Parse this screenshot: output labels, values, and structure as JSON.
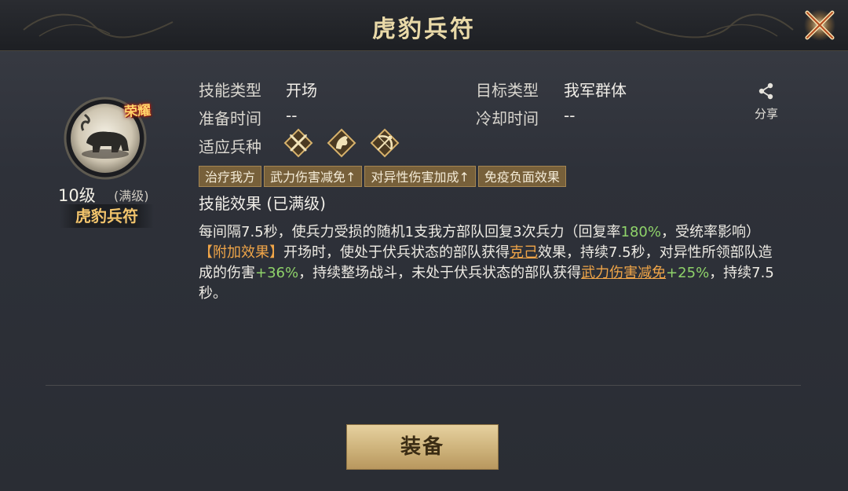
{
  "header": {
    "title": "虎豹兵符",
    "close_icon": "close-x-icon"
  },
  "skill": {
    "badge": "荣耀",
    "level": "10级",
    "level_note": "(满级)",
    "name": "虎豹兵符"
  },
  "info": {
    "skill_type_label": "技能类型",
    "skill_type_value": "开场",
    "target_type_label": "目标类型",
    "target_type_value": "我军群体",
    "prep_time_label": "准备时间",
    "prep_time_value": "--",
    "cooldown_label": "冷却时间",
    "cooldown_value": "--",
    "troop_label": "适应兵种",
    "troop_icons": [
      "crossed-spears-icon",
      "horse-icon",
      "bow-icon"
    ]
  },
  "share": {
    "label": "分享",
    "icon": "share-icon"
  },
  "tags": [
    "治疗我方",
    "武力伤害减免↑",
    "对异性伤害加成↑",
    "免疫负面效果"
  ],
  "effect": {
    "title": "技能效果 (已满级)",
    "line1_a": "每间隔7.5秒，使兵力受损的随机1支我方部队回复3次兵力（回复率",
    "line1_pct": "180%",
    "line1_b": "，受统率影响）",
    "extra_tag": "【附加效果】",
    "extra_a": "开场时，使处于伏兵状态的部队获得",
    "extra_link1": "克己",
    "extra_b": "效果，持续7.5秒，对异性所领部队造成的伤害",
    "extra_pct1": "+36%",
    "extra_c": "，持续整场战斗，未处于伏兵状态的部队获得",
    "extra_link2": "武力伤害减免",
    "extra_pct2": "+25%",
    "extra_d": "，持续7.5秒。"
  },
  "equip": {
    "label": "装备"
  }
}
